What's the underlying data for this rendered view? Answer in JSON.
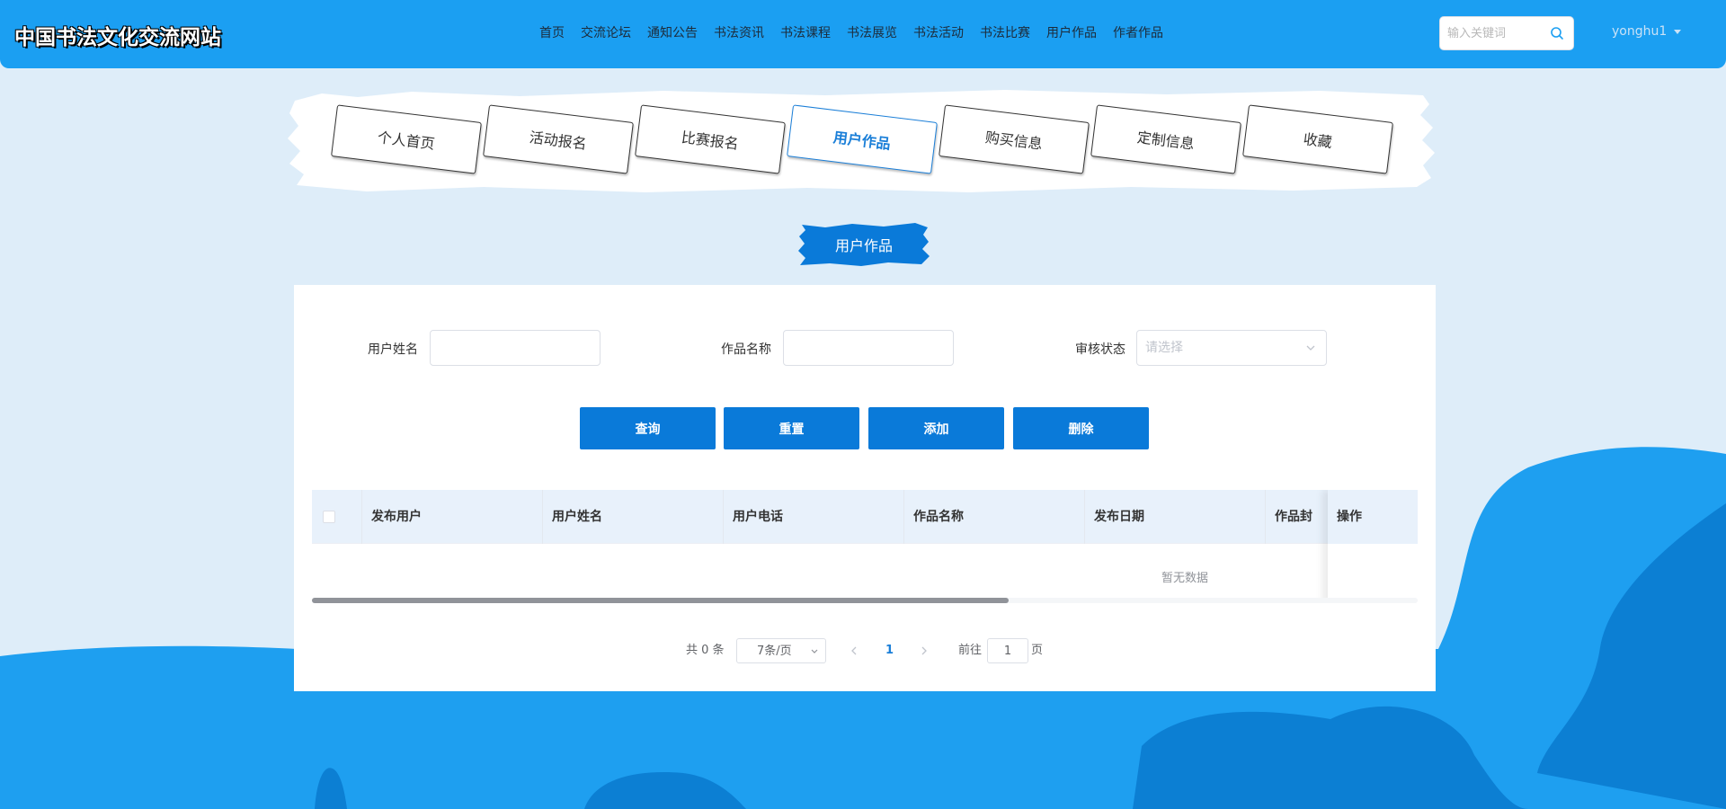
{
  "header": {
    "site_title": "中国书法文化交流网站",
    "nav": [
      "首页",
      "交流论坛",
      "通知公告",
      "书法资讯",
      "书法课程",
      "书法展览",
      "书法活动",
      "书法比赛",
      "用户作品",
      "作者作品"
    ],
    "search_placeholder": "输入关键词",
    "username": "yonghu1"
  },
  "tabs": [
    {
      "label": "个人首页",
      "active": false
    },
    {
      "label": "活动报名",
      "active": false
    },
    {
      "label": "比赛报名",
      "active": false
    },
    {
      "label": "用户作品",
      "active": true
    },
    {
      "label": "购买信息",
      "active": false
    },
    {
      "label": "定制信息",
      "active": false
    },
    {
      "label": "收藏",
      "active": false
    }
  ],
  "section_title": "用户作品",
  "filters": {
    "user_name_label": "用户姓名",
    "work_name_label": "作品名称",
    "review_status_label": "审核状态",
    "review_status_placeholder": "请选择"
  },
  "buttons": {
    "query": "查询",
    "reset": "重置",
    "add": "添加",
    "delete": "删除"
  },
  "table": {
    "columns": [
      "发布用户",
      "用户姓名",
      "用户电话",
      "作品名称",
      "发布日期",
      "作品封"
    ],
    "action_column": "操作",
    "empty_text": "暂无数据",
    "scroll_fraction": 0.63
  },
  "pagination": {
    "total": "共 0 条",
    "page_size": "7条/页",
    "current_page": "1",
    "goto_label": "前往",
    "goto_value": "1",
    "page_suffix": "页"
  },
  "colors": {
    "header_bg": "#1b9ff2",
    "accent": "#0a7ad9",
    "page_bg": "#deedf9"
  }
}
